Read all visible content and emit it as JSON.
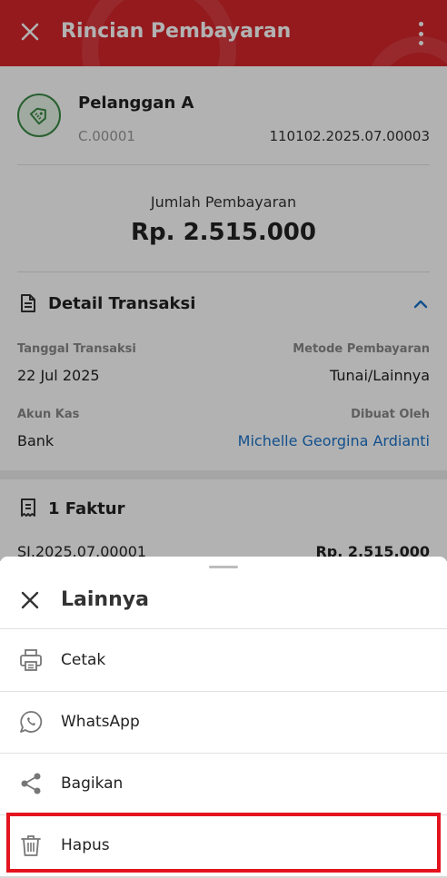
{
  "header": {
    "title": "Rincian Pembayaran",
    "close_icon": "close-icon",
    "more_icon": "more-vert-icon",
    "color": "#d4262b"
  },
  "customer": {
    "name": "Pelanggan A",
    "code": "C.00001",
    "transaction_number": "110102.2025.07.00003",
    "icon": "tag-icon"
  },
  "payment": {
    "label": "Jumlah Pembayaran",
    "amount": "Rp. 2.515.000"
  },
  "transaction_detail": {
    "title": "Detail Transaksi",
    "date_label": "Tanggal Transaksi",
    "date_value": "22 Jul 2025",
    "method_label": "Metode Pembayaran",
    "method_value": "Tunai/Lainnya",
    "cash_account_label": "Akun Kas",
    "cash_account_value": "Bank",
    "created_by_label": "Dibuat Oleh",
    "created_by_value": "Michelle Georgina Ardianti"
  },
  "invoices": {
    "title": "1 Faktur",
    "items": [
      {
        "number": "SI.2025.07.00001",
        "amount": "Rp. 2.515.000"
      }
    ]
  },
  "sheet": {
    "title": "Lainnya",
    "options": [
      {
        "label": "Cetak",
        "icon": "printer-icon"
      },
      {
        "label": "WhatsApp",
        "icon": "whatsapp-icon"
      },
      {
        "label": "Bagikan",
        "icon": "share-icon"
      },
      {
        "label": "Hapus",
        "icon": "trash-icon"
      }
    ],
    "highlight_color": "#e3141f"
  }
}
